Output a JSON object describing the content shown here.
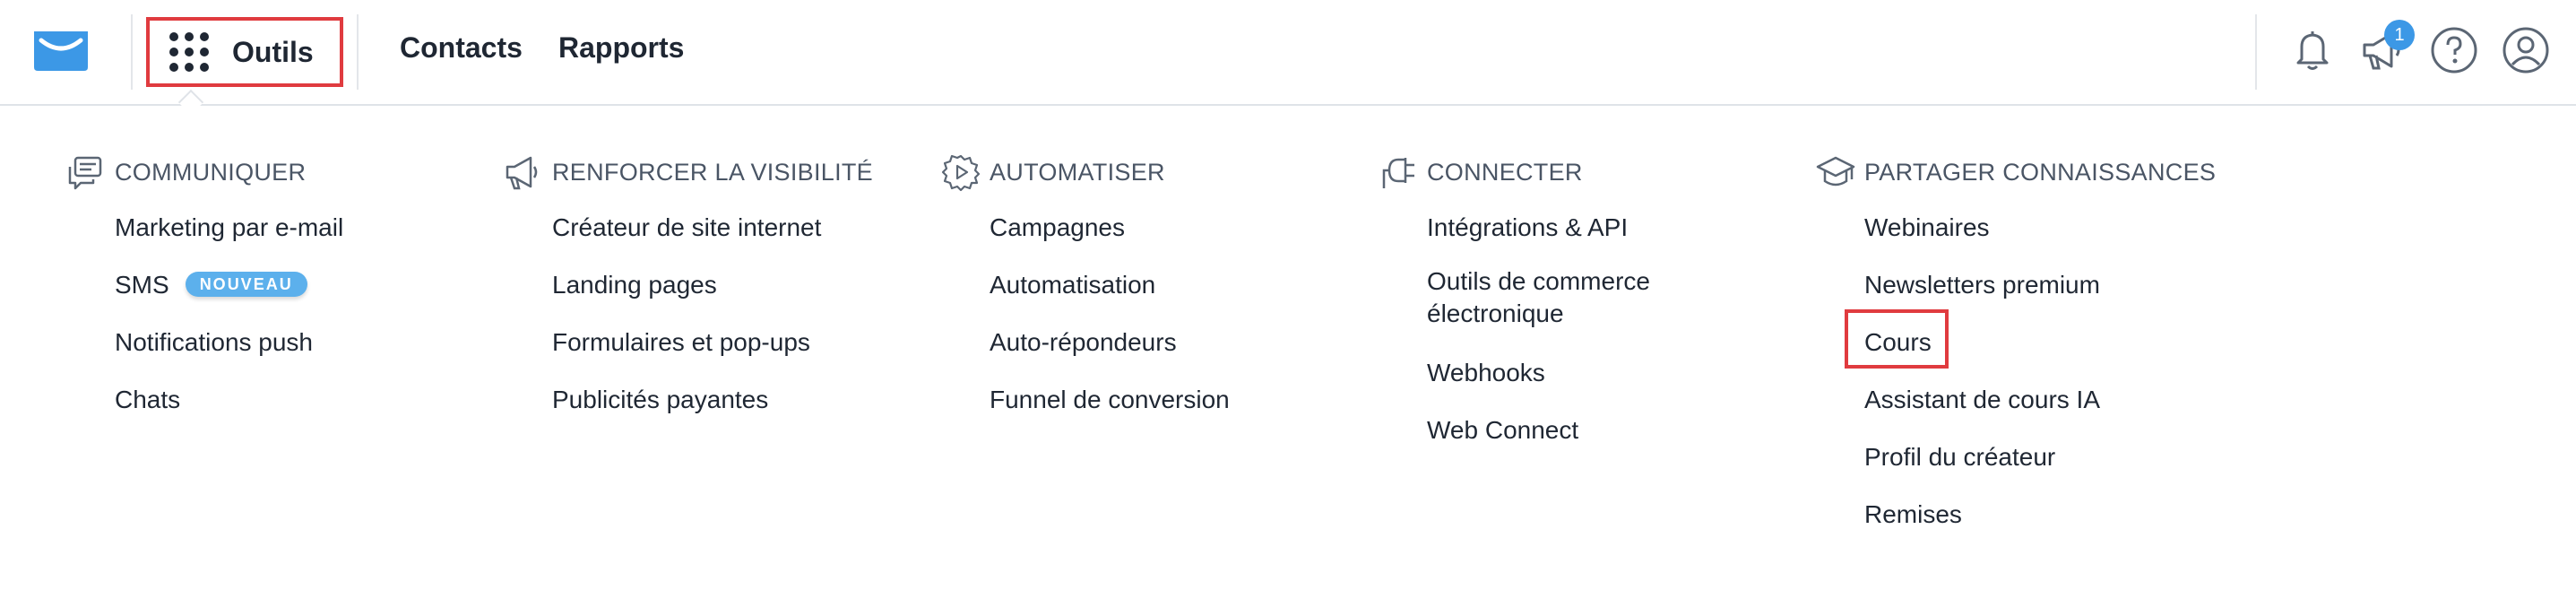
{
  "header": {
    "tools_label": "Outils",
    "nav": [
      "Contacts",
      "Rapports"
    ],
    "notification_badge": "1",
    "icons": [
      "getresponse-logo",
      "apps-grid-icon",
      "bell-icon",
      "megaphone-icon",
      "help-icon",
      "user-icon"
    ]
  },
  "menu": {
    "columns": [
      {
        "title": "COMMUNIQUER",
        "icon": "chat-icon",
        "items": [
          "Marketing par e-mail",
          "SMS",
          "Notifications push",
          "Chats"
        ],
        "sms_badge": "NOUVEAU"
      },
      {
        "title": "RENFORCER LA VISIBILITÉ",
        "icon": "megaphone-icon",
        "items": [
          "Créateur de site internet",
          "Landing pages",
          "Formulaires et pop-ups",
          "Publicités payantes"
        ]
      },
      {
        "title": "AUTOMATISER",
        "icon": "gear-play-icon",
        "items": [
          "Campagnes",
          "Automatisation",
          "Auto-répondeurs",
          "Funnel de conversion"
        ]
      },
      {
        "title": "CONNECTER",
        "icon": "plug-icon",
        "items": [
          "Intégrations & API",
          "Outils de commerce électronique",
          "Webhooks",
          "Web Connect"
        ]
      },
      {
        "title": "PARTAGER CONNAISSANCES",
        "icon": "graduation-cap-icon",
        "items": [
          "Webinaires",
          "Newsletters premium",
          "Cours",
          "Assistant de cours IA",
          "Profil du créateur",
          "Remises"
        ]
      }
    ]
  },
  "colors": {
    "accent": "#3c98e6",
    "highlight": "#e03b3f",
    "badge": "#5cb0ec",
    "text": "#1f2733"
  }
}
